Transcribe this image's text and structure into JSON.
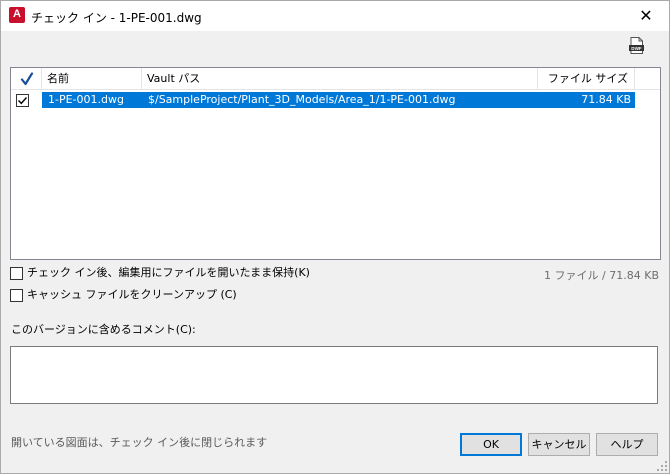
{
  "window": {
    "title": "チェック イン - 1-PE-001.dwg",
    "close_glyph": "✕",
    "app_icon_letter": "A",
    "app_icon_sub": "MEP"
  },
  "toolbar": {
    "dwf_icon": "dwf-file-icon"
  },
  "table": {
    "columns": {
      "check": "✔",
      "name": "名前",
      "path": "Vault パス",
      "size": "ファイル サイズ"
    },
    "rows": [
      {
        "checked": true,
        "selected": true,
        "name": "1-PE-001.dwg",
        "path": "$/SampleProject/Plant_3D_Models/Area_1/1-PE-001.dwg",
        "size": "71.84 KB"
      }
    ]
  },
  "options": {
    "keep_checked_out": {
      "label": "チェック イン後、編集用にファイルを開いたまま保持(K)",
      "checked": false
    },
    "cleanup_cache": {
      "label": "キャッシュ ファイルをクリーンアップ (C)",
      "checked": false
    }
  },
  "summary": "1 ファイル / 71.84 KB",
  "comment": {
    "label": "このバージョンに含めるコメント(C):",
    "value": ""
  },
  "footer": {
    "note": "開いている図面は、チェック イン後に閉じられます",
    "ok": "OK",
    "cancel": "キャンセル",
    "help": "ヘルプ"
  },
  "colors": {
    "selection": "#0078d7",
    "accent_brand": "#c8102e"
  }
}
